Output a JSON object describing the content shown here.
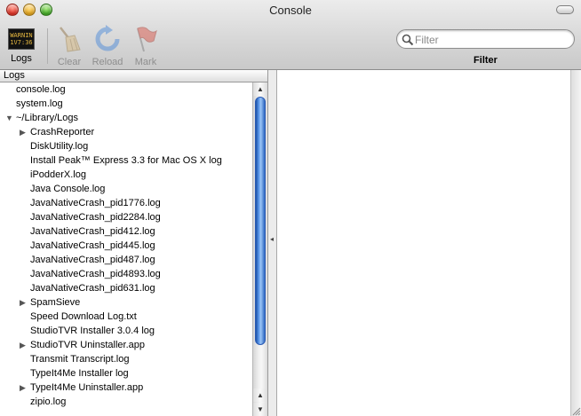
{
  "window": {
    "title": "Console"
  },
  "toolbar": {
    "logs": {
      "label": "Logs",
      "icon": "logs-icon",
      "icon_text": "WARNIN\n1V7:36"
    },
    "clear": {
      "label": "Clear",
      "icon": "broom-icon"
    },
    "reload": {
      "label": "Reload",
      "icon": "reload-icon"
    },
    "mark": {
      "label": "Mark",
      "icon": "flag-icon"
    },
    "filter": {
      "placeholder": "Filter",
      "value": "",
      "label": "Filter",
      "icon": "search-icon"
    }
  },
  "drawer": {
    "header": "Logs",
    "items": [
      {
        "label": "console.log",
        "indent": 0,
        "disclosure": ""
      },
      {
        "label": "system.log",
        "indent": 0,
        "disclosure": ""
      },
      {
        "label": "~/Library/Logs",
        "indent": 0,
        "disclosure": "open"
      },
      {
        "label": "CrashReporter",
        "indent": 1,
        "disclosure": "closed"
      },
      {
        "label": "DiskUtility.log",
        "indent": 1,
        "disclosure": ""
      },
      {
        "label": "Install Peak™ Express 3.3 for Mac OS X log",
        "indent": 1,
        "disclosure": ""
      },
      {
        "label": "iPodderX.log",
        "indent": 1,
        "disclosure": ""
      },
      {
        "label": "Java Console.log",
        "indent": 1,
        "disclosure": ""
      },
      {
        "label": "JavaNativeCrash_pid1776.log",
        "indent": 1,
        "disclosure": ""
      },
      {
        "label": "JavaNativeCrash_pid2284.log",
        "indent": 1,
        "disclosure": ""
      },
      {
        "label": "JavaNativeCrash_pid412.log",
        "indent": 1,
        "disclosure": ""
      },
      {
        "label": "JavaNativeCrash_pid445.log",
        "indent": 1,
        "disclosure": ""
      },
      {
        "label": "JavaNativeCrash_pid487.log",
        "indent": 1,
        "disclosure": ""
      },
      {
        "label": "JavaNativeCrash_pid4893.log",
        "indent": 1,
        "disclosure": ""
      },
      {
        "label": "JavaNativeCrash_pid631.log",
        "indent": 1,
        "disclosure": ""
      },
      {
        "label": "SpamSieve",
        "indent": 1,
        "disclosure": "closed"
      },
      {
        "label": "Speed Download Log.txt",
        "indent": 1,
        "disclosure": ""
      },
      {
        "label": "StudioTVR Installer 3.0.4 log",
        "indent": 1,
        "disclosure": ""
      },
      {
        "label": "StudioTVR Uninstaller.app",
        "indent": 1,
        "disclosure": "closed"
      },
      {
        "label": "Transmit Transcript.log",
        "indent": 1,
        "disclosure": ""
      },
      {
        "label": "TypeIt4Me Installer log",
        "indent": 1,
        "disclosure": ""
      },
      {
        "label": "TypeIt4Me Uninstaller.app",
        "indent": 1,
        "disclosure": "closed"
      },
      {
        "label": "zipio.log",
        "indent": 1,
        "disclosure": ""
      }
    ],
    "scrollbar": {
      "position": 0.0,
      "visible_fraction": 0.85
    }
  },
  "colors": {
    "scroll_thumb": "#5e9bed",
    "close": "#e0281b",
    "minimize": "#e8a413",
    "zoom": "#3aa91d"
  }
}
